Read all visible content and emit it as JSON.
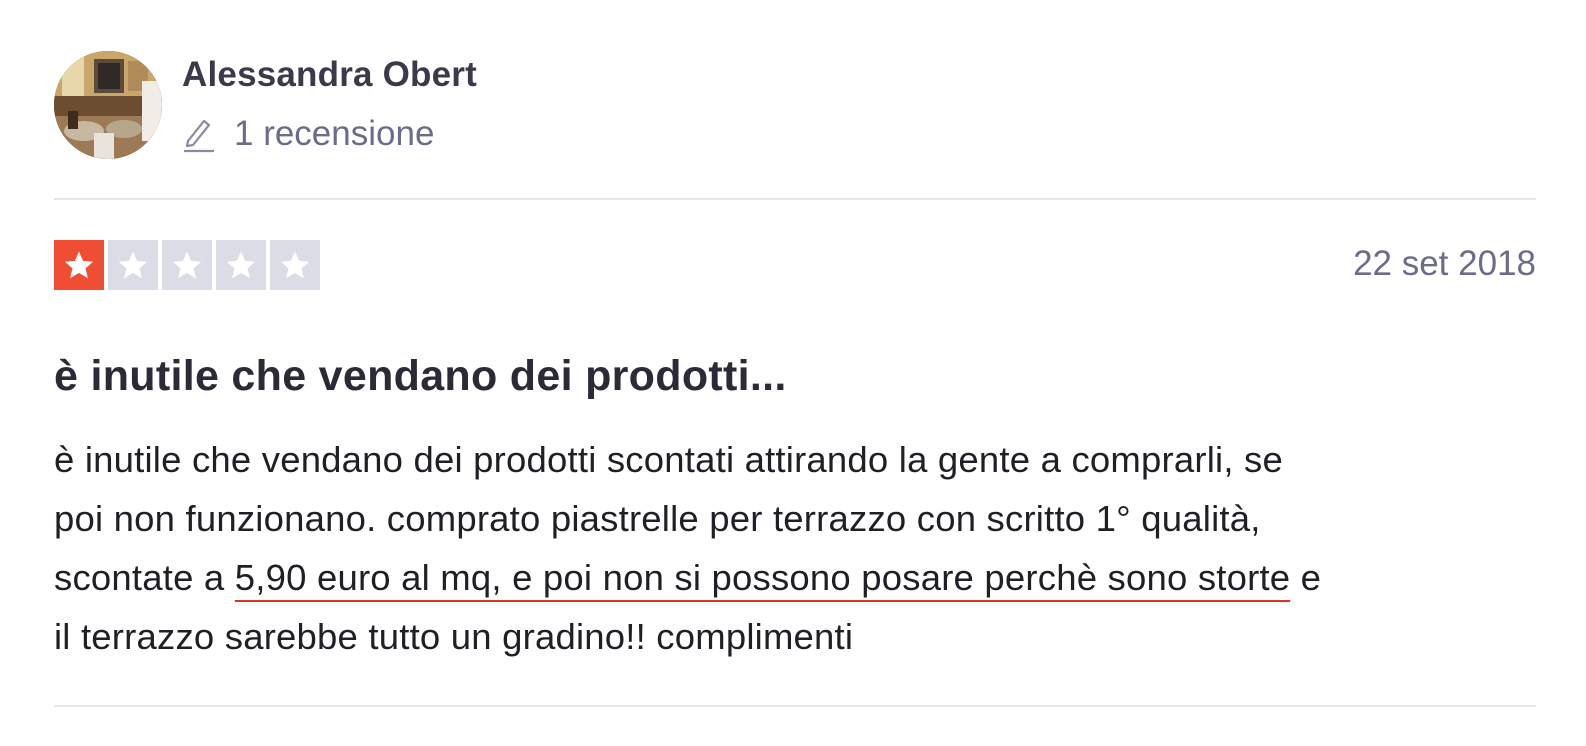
{
  "consumer": {
    "name": "Alessandra Obert",
    "review_count": "1 recensione",
    "avatar_icon": "avatar-photo",
    "count_icon": "pencil-icon"
  },
  "review": {
    "rating": 1,
    "rating_max": 5,
    "star_color_filled": "#f04e32",
    "star_color_empty": "#dcdce6",
    "date": "22 set 2018",
    "title": "è inutile che vendano dei prodotti...",
    "body_lines": [
      "è inutile che vendano dei prodotti scontati attirando la gente a comprarli, se",
      "poi non funzionano. comprato piastrelle per terrazzo con scritto 1° qualità,",
      "il terrazzo sarebbe tutto un gradino!! complimenti"
    ],
    "body_line3": {
      "before": "scontate a ",
      "underlined": "5,90 euro al mq, e poi non si possono posare perchè sono storte",
      "after": " e"
    }
  }
}
